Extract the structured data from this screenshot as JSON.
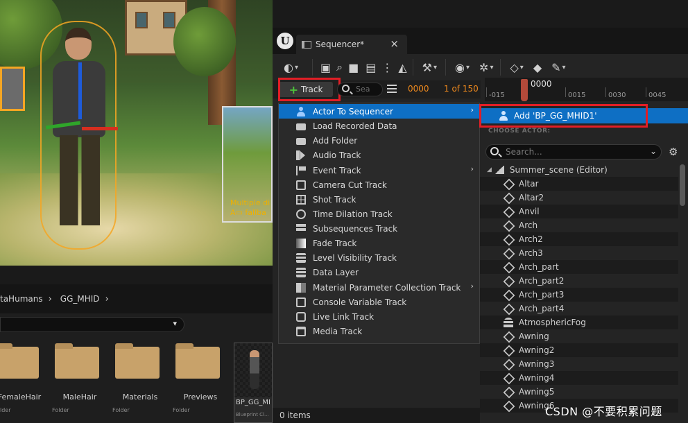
{
  "viewport": {
    "overlay_text_line1": "Multiple di",
    "overlay_text_line2": "A▭ fallba"
  },
  "content_browser": {
    "breadcrumb": [
      "taHumans",
      "GG_MHID"
    ],
    "items": [
      {
        "label": "FemaleHair",
        "type": "lder"
      },
      {
        "label": "MaleHair",
        "type": "Folder"
      },
      {
        "label": "Materials",
        "type": "Folder"
      },
      {
        "label": "Previews",
        "type": "Folder"
      }
    ],
    "bp_item": {
      "label": "BP_GG_MI",
      "type": "Blueprint Cl..."
    }
  },
  "sequencer": {
    "tab_title": "Sequencer*",
    "add_track_label": "Track",
    "search_placeholder": "Sea",
    "current_frame": "0000",
    "frame_count": "1 of 150",
    "timeline": {
      "current": "0000",
      "ticks": [
        "-015",
        "0015",
        "0030",
        "0045"
      ]
    },
    "status": "0 items"
  },
  "track_menu": {
    "items": [
      {
        "label": "Actor To Sequencer",
        "icon": "person-icon",
        "submenu": true,
        "active": true
      },
      {
        "label": "Load Recorded Data",
        "icon": "folder-icon",
        "submenu": false
      },
      {
        "label": "Add Folder",
        "icon": "folder-icon",
        "submenu": false
      },
      {
        "label": "Audio Track",
        "icon": "speaker-icon",
        "submenu": false
      },
      {
        "label": "Event Track",
        "icon": "flag-icon",
        "submenu": true
      },
      {
        "label": "Camera Cut Track",
        "icon": "camera-icon",
        "submenu": false
      },
      {
        "label": "Shot Track",
        "icon": "grid-icon",
        "submenu": false
      },
      {
        "label": "Time Dilation Track",
        "icon": "clock-icon",
        "submenu": false
      },
      {
        "label": "Subsequences Track",
        "icon": "strips-icon",
        "submenu": false
      },
      {
        "label": "Fade Track",
        "icon": "fade-icon",
        "submenu": false
      },
      {
        "label": "Level Visibility Track",
        "icon": "layers-icon",
        "submenu": false
      },
      {
        "label": "Data Layer",
        "icon": "layers-icon",
        "submenu": false
      },
      {
        "label": "Material Parameter Collection Track",
        "icon": "material-icon",
        "submenu": true
      },
      {
        "label": "Console Variable Track",
        "icon": "console-icon",
        "submenu": false
      },
      {
        "label": "Live Link Track",
        "icon": "link-icon",
        "submenu": false
      },
      {
        "label": "Media Track",
        "icon": "media-icon",
        "submenu": false
      }
    ]
  },
  "actor_picker": {
    "add_label": "Add 'BP_GG_MHID1'",
    "heading": "CHOOSE ACTOR:",
    "search_placeholder": "Search...",
    "root": "Summer_scene (Editor)",
    "actors": [
      "Altar",
      "Altar2",
      "Anvil",
      "Arch",
      "Arch2",
      "Arch3",
      "Arch_part",
      "Arch_part2",
      "Arch_part3",
      "Arch_part4",
      "AtmosphericFog",
      "Awning",
      "Awning2",
      "Awning3",
      "Awning4",
      "Awning5",
      "Awning6"
    ]
  },
  "watermark": "CSDN @不要积累问题",
  "colors": {
    "accent_blue": "#0e6fc4",
    "highlight_red": "#e21e26",
    "frame_orange": "#f08a1d",
    "add_green": "#4dc33b"
  }
}
